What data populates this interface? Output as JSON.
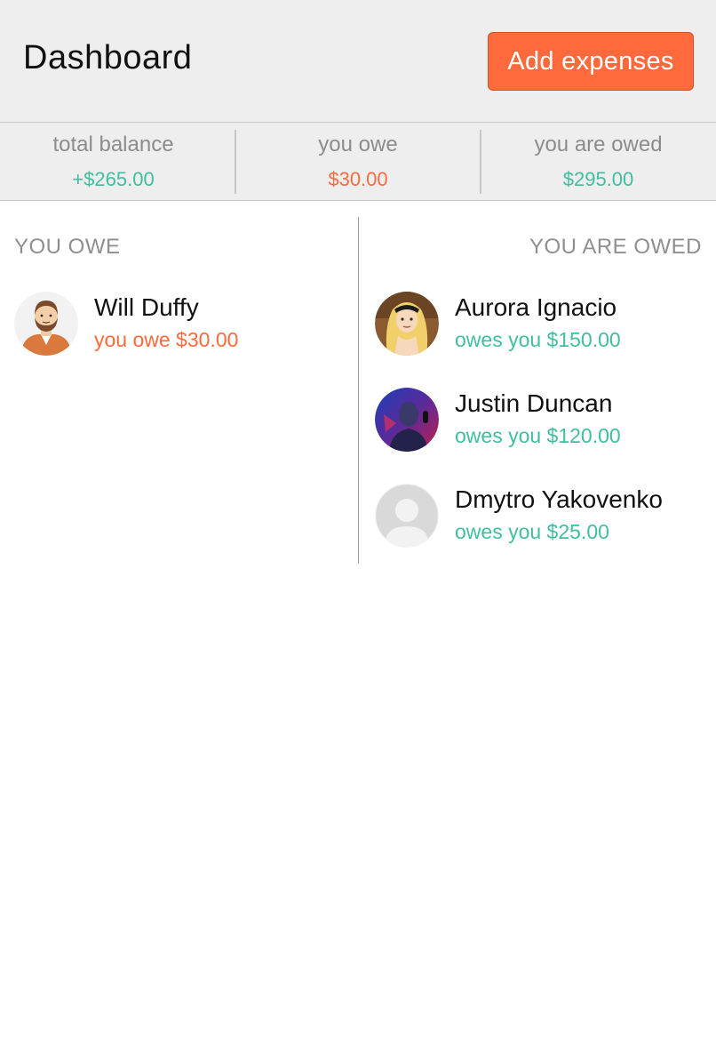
{
  "header": {
    "title": "Dashboard",
    "add_button_label": "Add expenses"
  },
  "balances": {
    "total": {
      "label": "total balance",
      "value": "+$265.00"
    },
    "owe": {
      "label": "you owe",
      "value": "$30.00"
    },
    "owed": {
      "label": "you are owed",
      "value": "$295.00"
    }
  },
  "you_owe": {
    "heading": "YOU OWE",
    "people": [
      {
        "name": "Will Duffy",
        "amount": "you owe $30.00",
        "avatar": "bearded-man-avatar-icon"
      }
    ]
  },
  "you_are_owed": {
    "heading": "YOU ARE OWED",
    "people": [
      {
        "name": "Aurora Ignacio",
        "amount": "owes you $150.00",
        "avatar": "princess-avatar-icon"
      },
      {
        "name": "Justin Duncan",
        "amount": "owes you $120.00",
        "avatar": "singer-photo-avatar-icon"
      },
      {
        "name": "Dmytro Yakovenko",
        "amount": "owes you $25.00",
        "avatar": "default-user-avatar-icon"
      }
    ]
  },
  "colors": {
    "accent_orange": "#ff6a3d",
    "accent_green": "#3fbfa0",
    "header_bg": "#eeeeee"
  }
}
